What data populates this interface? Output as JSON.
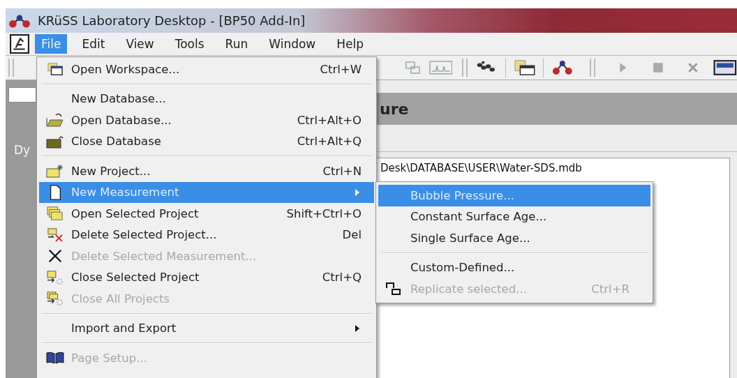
{
  "window": {
    "title": "KRüSS Laboratory Desktop - [BP50 Add-In]"
  },
  "menu_bar": [
    {
      "label": "File",
      "selected": true
    },
    {
      "label": "Edit",
      "selected": false
    },
    {
      "label": "View",
      "selected": false
    },
    {
      "label": "Tools",
      "selected": false
    },
    {
      "label": "Run",
      "selected": false
    },
    {
      "label": "Window",
      "selected": false
    },
    {
      "label": "Help",
      "selected": false
    }
  ],
  "panel": {
    "header": "ure",
    "sidebar_label": "Dy",
    "path": "Desk\\DATABASE\\USER\\Water-SDS.mdb"
  },
  "file_menu": [
    {
      "kind": "item",
      "label": "Open Workspace...",
      "shortcut": "Ctrl+W",
      "disabled": false,
      "selected": false
    },
    {
      "kind": "separator"
    },
    {
      "kind": "item",
      "label": "New Database...",
      "disabled": false,
      "selected": false
    },
    {
      "kind": "item",
      "label": "Open Database...",
      "shortcut": "Ctrl+Alt+O",
      "disabled": false,
      "selected": false
    },
    {
      "kind": "item",
      "label": "Close Database",
      "shortcut": "Ctrl+Alt+Q",
      "disabled": false,
      "selected": false
    },
    {
      "kind": "separator"
    },
    {
      "kind": "item",
      "label": "New Project...",
      "shortcut": "Ctrl+N",
      "disabled": false,
      "selected": false
    },
    {
      "kind": "submenu",
      "label": "New Measurement",
      "disabled": false,
      "selected": true
    },
    {
      "kind": "item",
      "label": "Open Selected Project",
      "shortcut": "Shift+Ctrl+O",
      "disabled": false,
      "selected": false
    },
    {
      "kind": "item",
      "label": "Delete Selected Project...",
      "shortcut": "Del",
      "disabled": false,
      "selected": false
    },
    {
      "kind": "item",
      "label": "Delete Selected Measurement...",
      "disabled": true,
      "selected": false
    },
    {
      "kind": "item",
      "label": "Close Selected Project",
      "shortcut": "Ctrl+Q",
      "disabled": false,
      "selected": false
    },
    {
      "kind": "item",
      "label": "Close All Projects",
      "disabled": true,
      "selected": false
    },
    {
      "kind": "separator"
    },
    {
      "kind": "submenu",
      "label": "Import and Export",
      "disabled": false,
      "selected": false
    },
    {
      "kind": "separator"
    },
    {
      "kind": "item",
      "label": "Page Setup...",
      "disabled": true,
      "selected": false
    }
  ],
  "submenu": [
    {
      "kind": "item",
      "label": "Bubble Pressure...",
      "disabled": false,
      "selected": true
    },
    {
      "kind": "item",
      "label": "Constant Surface Age...",
      "disabled": false,
      "selected": false
    },
    {
      "kind": "item",
      "label": "Single Surface Age...",
      "disabled": false,
      "selected": false
    },
    {
      "kind": "separator"
    },
    {
      "kind": "item",
      "label": "Custom-Defined...",
      "disabled": false,
      "selected": false
    },
    {
      "kind": "item",
      "label": "Replicate selected...",
      "shortcut": "Ctrl+R",
      "disabled": true,
      "selected": false
    }
  ]
}
